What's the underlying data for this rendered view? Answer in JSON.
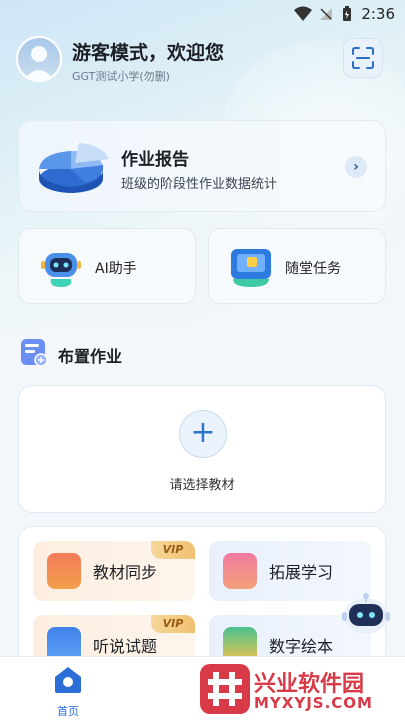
{
  "status_bar": {
    "time": "2:36"
  },
  "header": {
    "greeting": "游客模式，欢迎您",
    "school": "GGT测试小学(勿删)"
  },
  "report_card": {
    "title": "作业报告",
    "subtitle": "班级的阶段性作业数据统计"
  },
  "quick_actions": [
    {
      "label": "AI助手"
    },
    {
      "label": "随堂任务"
    }
  ],
  "assign_section": {
    "title": "布置作业",
    "picker_label": "请选择教材"
  },
  "features": [
    {
      "label": "教材同步",
      "badge": "VIP"
    },
    {
      "label": "拓展学习",
      "badge": ""
    },
    {
      "label": "听说试题",
      "badge": "VIP"
    },
    {
      "label": "数字绘本",
      "badge": ""
    }
  ],
  "tabbar": {
    "home_label": "首页"
  },
  "watermark": {
    "name": "兴业软件园",
    "domain": "MYXYJS.COM"
  },
  "colors": {
    "accent": "#2b6fd6",
    "vip": "#efc170",
    "watermark": "#d93a47"
  }
}
